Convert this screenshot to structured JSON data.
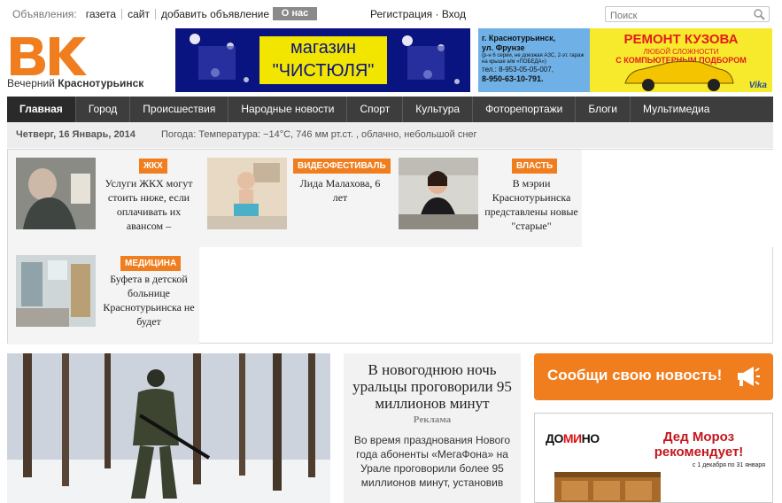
{
  "topbar": {
    "ads_label": "Объявления:",
    "ads_links": [
      "газета",
      "сайт",
      "добавить объявление"
    ],
    "about": "О нас",
    "auth": "Регистрация · Вход",
    "search_placeholder": "Поиск"
  },
  "logo": {
    "mark": "ВК",
    "name_a": "Вечерний",
    "name_b": "Краснотурьинск"
  },
  "banners": {
    "b1_line1": "магазин",
    "b1_line2": "\"ЧИСТЮЛЯ\"",
    "b2_city": "г. Краснотурьинск,",
    "b2_street": "ул. Фрунзе",
    "b2_note": "(р-н 6 серии, не доезжая АЗС, 2-эт. гараж на крыше а/м «ПОБЕДА»)",
    "b2_tel1": "тел.: 8-953-05-05-007,",
    "b2_tel2": "8-950-63-10-791.",
    "b2_title": "РЕМОНТ КУЗОВА",
    "b2_sub1": "ЛЮБОЙ СЛОЖНОСТИ",
    "b2_sub2": "С КОМПЬЮТЕРНЫМ ПОДБОРОМ АВТОЭМАЛЕЙ",
    "b2_brand": "Vika"
  },
  "nav": [
    "Главная",
    "Город",
    "Происшествия",
    "Народные новости",
    "Спорт",
    "Культура",
    "Фоторепортажи",
    "Блоги",
    "Мультимедиа"
  ],
  "info": {
    "date": "Четверг, 16 Январь, 2014",
    "weather": "Погода: Температура: −14°C, 746 мм рт.ст. , облачно, небольшой снег"
  },
  "news": [
    {
      "tag": "ЖКХ",
      "title": "Услуги ЖКХ могут стоить ниже, если оплачивать их авансом –"
    },
    {
      "tag": "ВИДЕОФЕСТИВАЛЬ",
      "title": "Лида Малахова, 6 лет"
    },
    {
      "tag": "ВЛАСТЬ",
      "title": "В мэрии Краснотурьинска представлены новые \"старые\""
    },
    {
      "tag": "МЕДИЦИНА",
      "title": "Буфета в детской больнице Краснотурьинска не будет"
    }
  ],
  "feature": {
    "headline": "В новогоднюю ночь уральцы проговорили 95 миллионов минут",
    "tag": "Реклама",
    "text": "Во время празднования Нового года абоненты «МегаФона» на Урале проговорили более 95 миллионов минут, установив"
  },
  "report": {
    "label": "Сообщи свою новость!"
  },
  "domino": {
    "logo_a": "ДО",
    "logo_b": "МИ",
    "logo_c": "НО",
    "msg": "Дед Мороз рекомендует!",
    "dates": "с 1 декабря по 31 января"
  },
  "colors": {
    "accent": "#f07e1e",
    "nav": "#3d3d3d"
  }
}
